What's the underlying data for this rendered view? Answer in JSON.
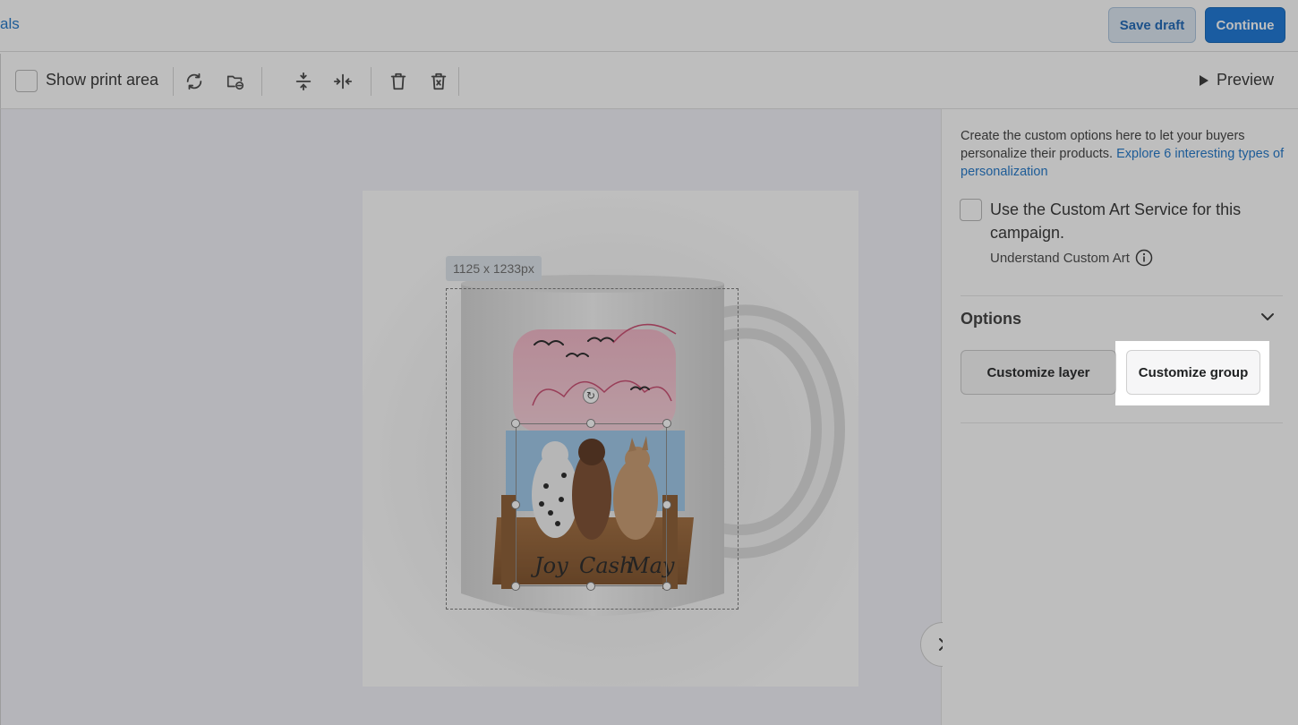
{
  "header": {
    "crumb_text": "als",
    "save_draft_label": "Save draft",
    "continue_label": "Continue"
  },
  "toolbar": {
    "show_print_area_label": "Show print area",
    "preview_label": "Preview",
    "icons": [
      "replace-icon",
      "folder-replace-icon",
      "align-vertical-center-icon",
      "align-horizontal-center-icon",
      "delete-icon",
      "delete-all-icon"
    ]
  },
  "canvas": {
    "size_label": "1125 x 1233px",
    "pet_names": [
      "Joy",
      "Cash",
      "May"
    ]
  },
  "panel": {
    "description": "Create the custom options here to let your buyers personalize their products.",
    "explore_link": "Explore 6 interesting types of personalization",
    "custom_art_label": "Use the Custom Art Service for this campaign.",
    "custom_art_sub": "Understand Custom Art",
    "options_title": "Options",
    "customize_layer_label": "Customize layer",
    "customize_group_label": "Customize group"
  },
  "colors": {
    "accent": "#1573d6",
    "link": "#1a73c8",
    "overlay": "rgba(40,40,40,0.3)"
  }
}
